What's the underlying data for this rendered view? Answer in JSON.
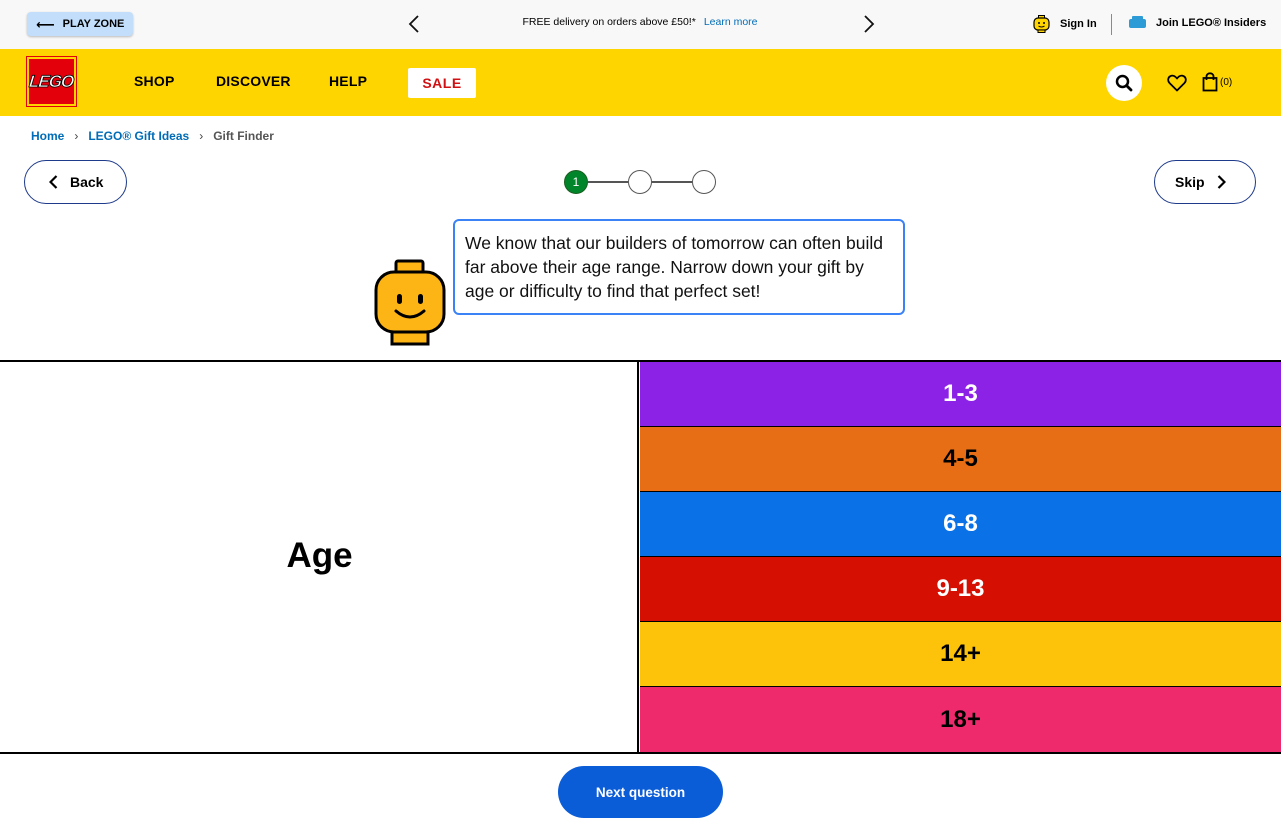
{
  "util_bar": {
    "play_zone_label": "PLAY ZONE",
    "promo_text": "FREE delivery on orders above £50!*",
    "promo_link": "Learn more",
    "sign_in": "Sign In",
    "insiders": "Join LEGO® Insiders"
  },
  "nav": {
    "logo_text": "LEGO",
    "items": [
      "SHOP",
      "DISCOVER",
      "HELP"
    ],
    "sale": "SALE",
    "bag_count": "(0)"
  },
  "breadcrumb": {
    "items": [
      "Home",
      "LEGO® Gift Ideas",
      "Gift Finder"
    ]
  },
  "quiz": {
    "back_label": "Back",
    "skip_label": "Skip",
    "steps": [
      "1",
      "",
      ""
    ],
    "current_step": 1,
    "bubble_text": "We know that our builders of tomorrow can often build far above their age range. Narrow down your gift by age or difficulty to find that perfect set!",
    "question_title": "Age",
    "options": [
      {
        "label": "1-3",
        "color": "#8b22e6",
        "text_color": "#ffffff"
      },
      {
        "label": "4-5",
        "color": "#e76e15",
        "text_color": "#000000"
      },
      {
        "label": "6-8",
        "color": "#0a72e6",
        "text_color": "#ffffff"
      },
      {
        "label": "9-13",
        "color": "#d50f01",
        "text_color": "#ffffff"
      },
      {
        "label": "14+",
        "color": "#fdc20a",
        "text_color": "#000000"
      },
      {
        "label": "18+",
        "color": "#ef2a6c",
        "text_color": "#000000"
      }
    ],
    "next_label": "Next question"
  },
  "colors": {
    "brand_yellow": "#ffd500",
    "brand_red": "#e3000b",
    "link_blue": "#006cb7",
    "primary_button": "#0b5dd7"
  }
}
